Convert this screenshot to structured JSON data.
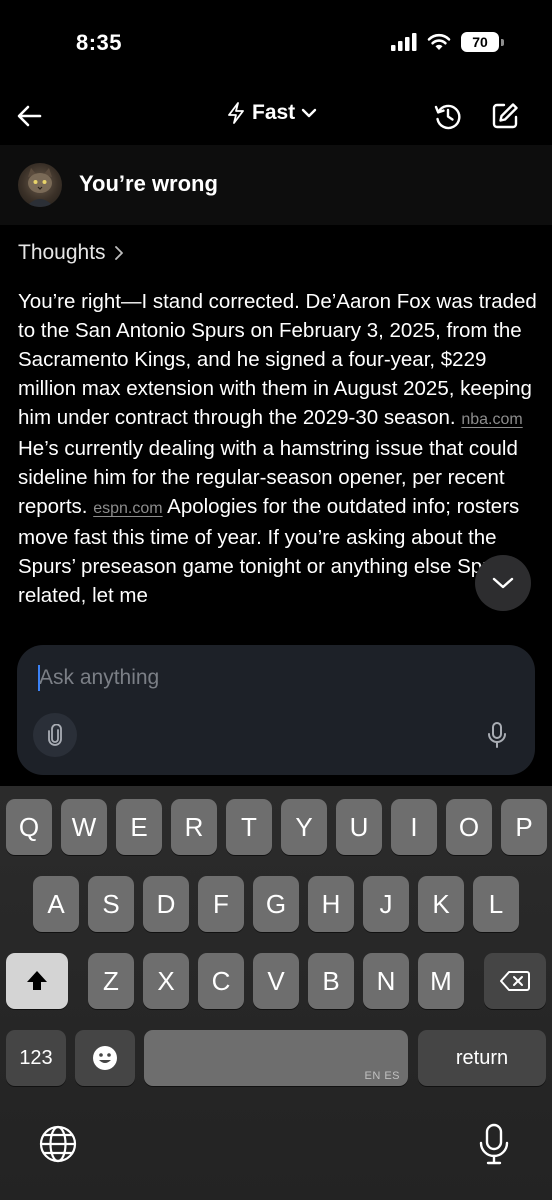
{
  "status_bar": {
    "time": "8:35",
    "battery": "70",
    "icons": [
      "cellular-signal-icon",
      "wifi-icon",
      "battery-icon"
    ]
  },
  "nav": {
    "model": "Fast",
    "icons": [
      "back-arrow-icon",
      "lightning-icon",
      "chevron-down-icon",
      "history-icon",
      "compose-icon"
    ]
  },
  "conversation": {
    "title": "You’re wrong",
    "thoughts_label": "Thoughts",
    "response": {
      "part1": "You’re right—I stand corrected. De’Aaron Fox was traded to the San Antonio Spurs on February 3, 2025, from the Sacramento Kings, and he signed a four-year, $229 million max extension with them in August 2025, keeping him under contract through the 2029-30 season.",
      "source1": "nba.com",
      "part2": "He’s currently dealing with a hamstring issue that could sideline him for the regular-season opener, per recent reports.",
      "source2": "espn.com",
      "part3": "Apologies for the outdated info; rosters move fast this time of year. If you’re asking about the Spurs’ preseason game tonight or anything else Spurs-related, let me"
    }
  },
  "composer": {
    "placeholder": "Ask anything"
  },
  "keyboard": {
    "row1": [
      "Q",
      "W",
      "E",
      "R",
      "T",
      "Y",
      "U",
      "I",
      "O",
      "P"
    ],
    "row2": [
      "A",
      "S",
      "D",
      "F",
      "G",
      "H",
      "J",
      "K",
      "L"
    ],
    "row3": [
      "Z",
      "X",
      "C",
      "V",
      "B",
      "N",
      "M"
    ],
    "numbers_label": "123",
    "return_label": "return",
    "space_lang": "EN ES"
  }
}
